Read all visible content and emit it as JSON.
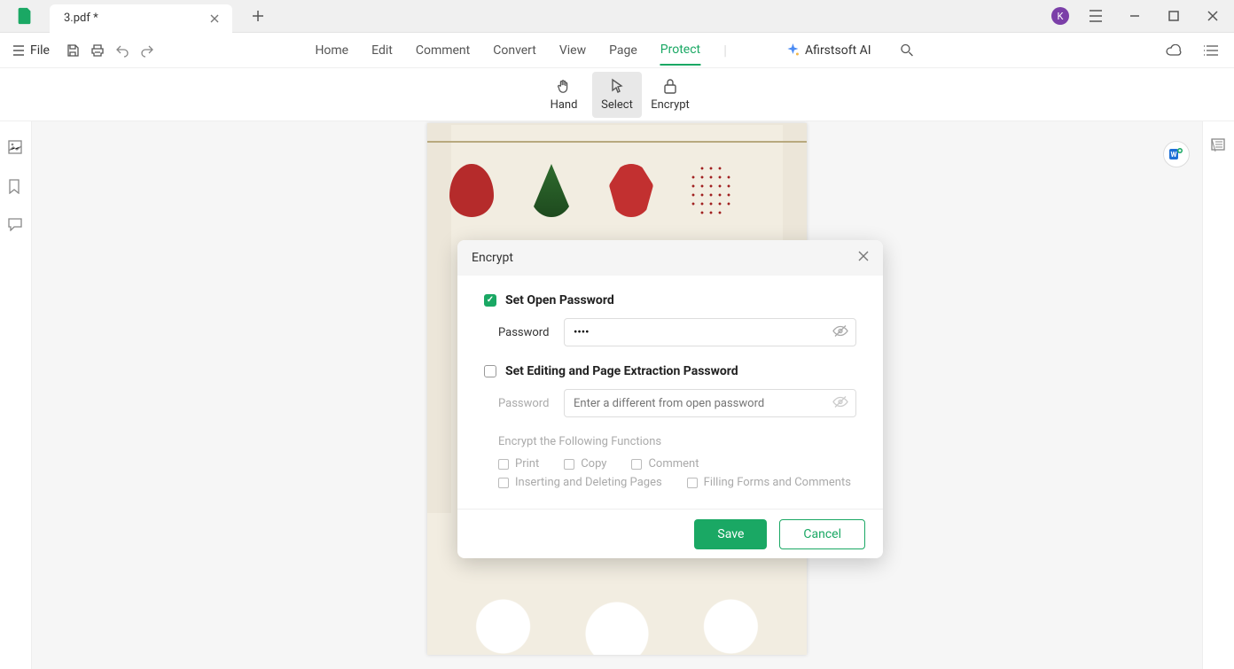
{
  "titlebar": {
    "tab_title": "3.pdf *",
    "avatar_letter": "K"
  },
  "menubar": {
    "file": "File",
    "items": [
      "Home",
      "Edit",
      "Comment",
      "Convert",
      "View",
      "Page",
      "Protect"
    ],
    "active_index": 6,
    "ai_label": "Afirstsoft AI"
  },
  "toolbar": {
    "hand": "Hand",
    "select": "Select",
    "encrypt": "Encrypt"
  },
  "dialog": {
    "title": "Encrypt",
    "open_pw": {
      "checked": true,
      "title": "Set Open Password",
      "label": "Password",
      "value": "••••"
    },
    "edit_pw": {
      "checked": false,
      "title": "Set Editing and Page Extraction Password",
      "label": "Password",
      "placeholder": "Enter a different from open password"
    },
    "functions_header": "Encrypt the Following Functions",
    "functions": [
      "Print",
      "Copy",
      "Comment",
      "Inserting and Deleting Pages",
      "Filling Forms and Comments"
    ],
    "save": "Save",
    "cancel": "Cancel"
  },
  "colors": {
    "accent": "#1aa864"
  }
}
